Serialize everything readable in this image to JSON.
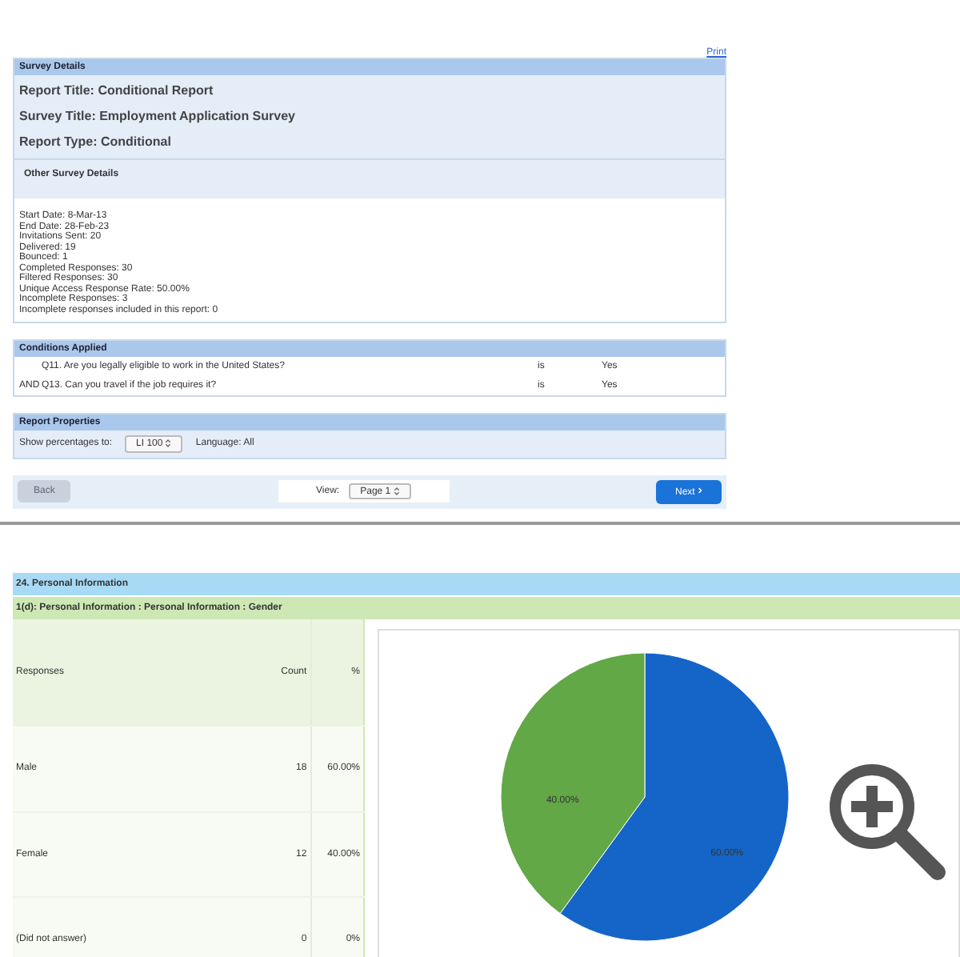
{
  "print_link": "Print",
  "survey_details": {
    "header": "Survey Details",
    "titles": [
      "Report Title: Conditional Report",
      "Survey Title: Employment Application Survey",
      "Report Type: Conditional"
    ],
    "other_header": "Other Survey Details",
    "details": [
      "Start Date: 8-Mar-13",
      "End Date: 28-Feb-23",
      "Invitations Sent: 20",
      "Delivered: 19",
      "Bounced: 1",
      "Completed Responses: 30",
      "Filtered Responses: 30",
      "Unique Access Response Rate: 50.00%",
      "Incomplete Responses: 3",
      "Incomplete responses included in this report: 0"
    ]
  },
  "conditions": {
    "header": "Conditions Applied",
    "rows": [
      {
        "joiner": "",
        "question": "Q11. Are you legally eligible to work in the United States?",
        "operator": "is",
        "value": "Yes"
      },
      {
        "joiner": "AND",
        "question": "Q13. Can you travel if the job requires it?",
        "operator": "is",
        "value": "Yes"
      }
    ]
  },
  "report_properties": {
    "header": "Report Properties",
    "show_label": "Show percentages to:",
    "show_value": "LI 100",
    "language": "Language: All"
  },
  "nav": {
    "back": "Back",
    "back_disabled": true,
    "view_label": "View:",
    "view_value": "Page 1",
    "next": "Next"
  },
  "section": {
    "header": "24. Personal Information",
    "question": "1(d): Personal Information : Personal Information : Gender",
    "columns": [
      "Responses",
      "Count",
      "%"
    ],
    "rows": [
      {
        "response": "Male",
        "count": "18",
        "percent": "60.00%"
      },
      {
        "response": "Female",
        "count": "12",
        "percent": "40.00%"
      },
      {
        "response": "(Did not answer)",
        "count": "0",
        "percent": "0%"
      }
    ],
    "chart_data": {
      "type": "pie",
      "values": [
        60,
        40
      ],
      "colors": [
        "#1565c8",
        "#62a846"
      ],
      "data_labels": true,
      "value_labels": [
        "60.00%",
        "40.00%"
      ]
    }
  }
}
